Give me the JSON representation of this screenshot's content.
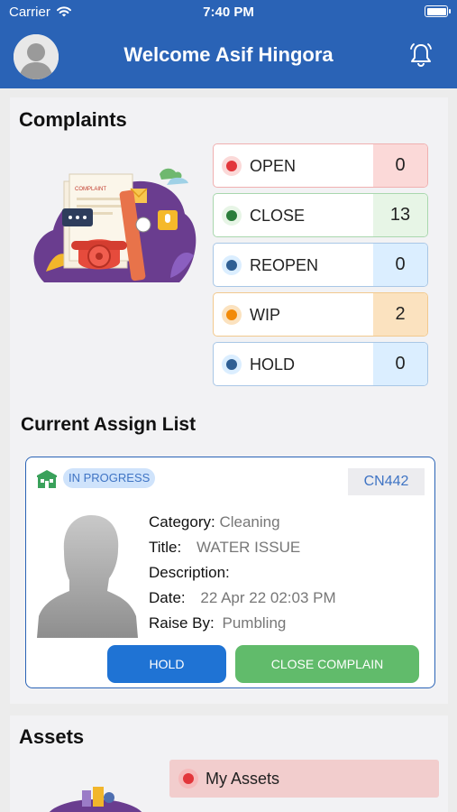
{
  "status_bar": {
    "carrier": "Carrier",
    "time": "7:40 PM"
  },
  "header": {
    "welcome": "Welcome Asif Hingora"
  },
  "complaints": {
    "title": "Complaints",
    "illustration_text": "COMPLAINT",
    "stats": [
      {
        "label": "OPEN",
        "count": "0",
        "dot_color": "#e2363b",
        "bg": "#fbd9d8",
        "border": "#f0b0b0"
      },
      {
        "label": "CLOSE",
        "count": "13",
        "dot_color": "#2b7d3b",
        "bg": "#e7f5e6",
        "border": "#a9d7ae"
      },
      {
        "label": "REOPEN",
        "count": "0",
        "dot_color": "#2f5f94",
        "bg": "#dbeeff",
        "border": "#a9c7e6"
      },
      {
        "label": "WIP",
        "count": "2",
        "dot_color": "#f28a08",
        "bg": "#fbe2bf",
        "border": "#f2c98e"
      },
      {
        "label": "HOLD",
        "count": "0",
        "dot_color": "#2f5f94",
        "bg": "#dbeeff",
        "border": "#a9c7e6"
      }
    ]
  },
  "assign_list": {
    "title": "Current Assign List",
    "item": {
      "status": "IN PROGRESS",
      "number": "CN442",
      "category_label": "Category:",
      "category_value": "Cleaning",
      "title_label": "Title:",
      "title_value": "WATER ISSUE",
      "description_label": "Description:",
      "description_value": "",
      "date_label": "Date:",
      "date_value": "22 Apr 22 02:03 PM",
      "raised_by_label": "Raise By:",
      "raised_by_value": "Pumbling",
      "hold_button": "HOLD",
      "close_button": "CLOSE COMPLAIN"
    }
  },
  "assets": {
    "title": "Assets",
    "items": [
      {
        "label": "My Assets"
      }
    ]
  }
}
